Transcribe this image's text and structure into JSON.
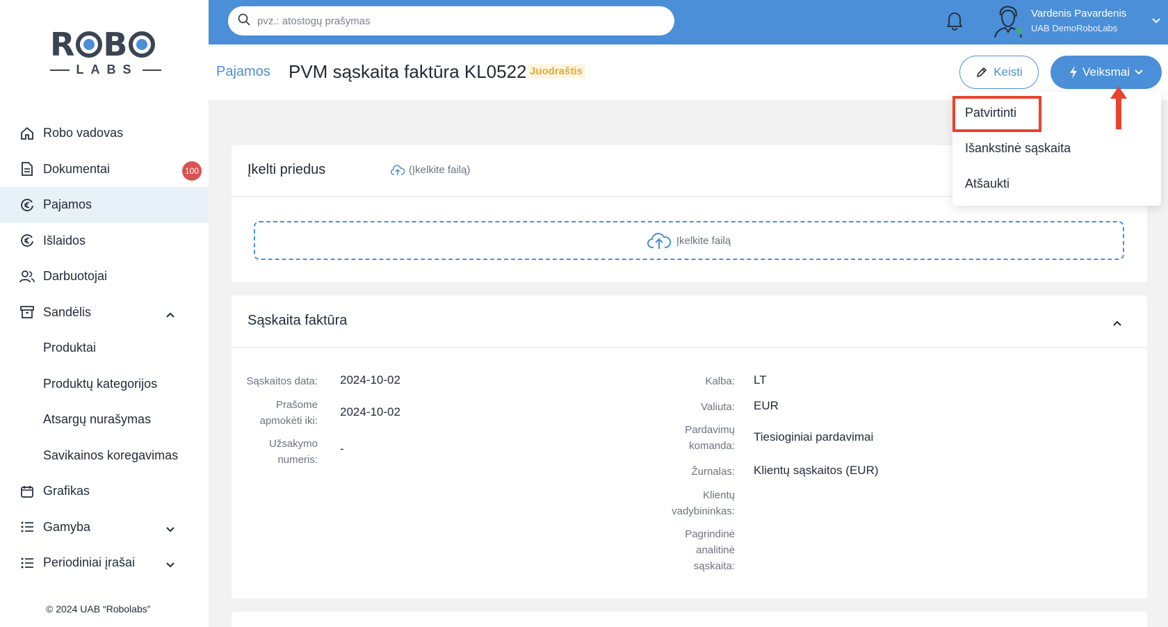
{
  "sidebar": {
    "copyright": "© 2024 UAB “Robolabs”",
    "items": [
      {
        "label": "Robo vadovas"
      },
      {
        "label": "Dokumentai",
        "badge": "100"
      },
      {
        "label": "Pajamos"
      },
      {
        "label": "Išlaidos"
      },
      {
        "label": "Darbuotojai"
      },
      {
        "label": "Sandėlis"
      },
      {
        "label": "Produktai"
      },
      {
        "label": "Produktų kategorijos"
      },
      {
        "label": "Atsargų nurašymas"
      },
      {
        "label": "Savikainos koregavimas"
      },
      {
        "label": "Grafikas"
      },
      {
        "label": "Gamyba"
      },
      {
        "label": "Periodiniai įrašai"
      }
    ]
  },
  "topbar": {
    "search_placeholder": "pvz.: atostogų prašymas",
    "user_name": "Vardenis Pavardenis",
    "user_company": "UAB DemoRoboLabs"
  },
  "header": {
    "breadcrumb": "Pajamos",
    "title": "PVM sąskaita faktūra KL0522",
    "status": "Juodraštis",
    "edit_label": "Keisti",
    "actions_label": "Veiksmai"
  },
  "actions_menu": {
    "items": [
      "Patvirtinti",
      "Išankstinė sąskaita",
      "Atšaukti"
    ]
  },
  "attachments": {
    "title": "Įkelti priedus",
    "link": "(Įkelkite failą)",
    "dropzone": "Įkelkite failą"
  },
  "invoice": {
    "title": "Sąskaita faktūra",
    "left": [
      {
        "label": "Sąskaitos data:",
        "value": "2024-10-02"
      },
      {
        "label": "Prašome apmokėti iki:",
        "value": "2024-10-02"
      },
      {
        "label": "Užsakymo numeris:",
        "value": "-"
      }
    ],
    "right": [
      {
        "label": "Kalba:",
        "value": "LT"
      },
      {
        "label": "Valiuta:",
        "value": "EUR"
      },
      {
        "label": "Pardavimų komanda:",
        "value": "Tiesioginiai pardavimai"
      },
      {
        "label": "Žurnalas:",
        "value": "Klientų sąskaitos (EUR)"
      },
      {
        "label": "Klientų vadybininkas:",
        "value": ""
      },
      {
        "label": "Pagrindinė analitinė sąskaita:",
        "value": ""
      }
    ]
  },
  "colors": {
    "accent": "#4a8fd8",
    "highlight": "#e8432f",
    "badge": "#d9534f",
    "status": "#e8a92e"
  }
}
